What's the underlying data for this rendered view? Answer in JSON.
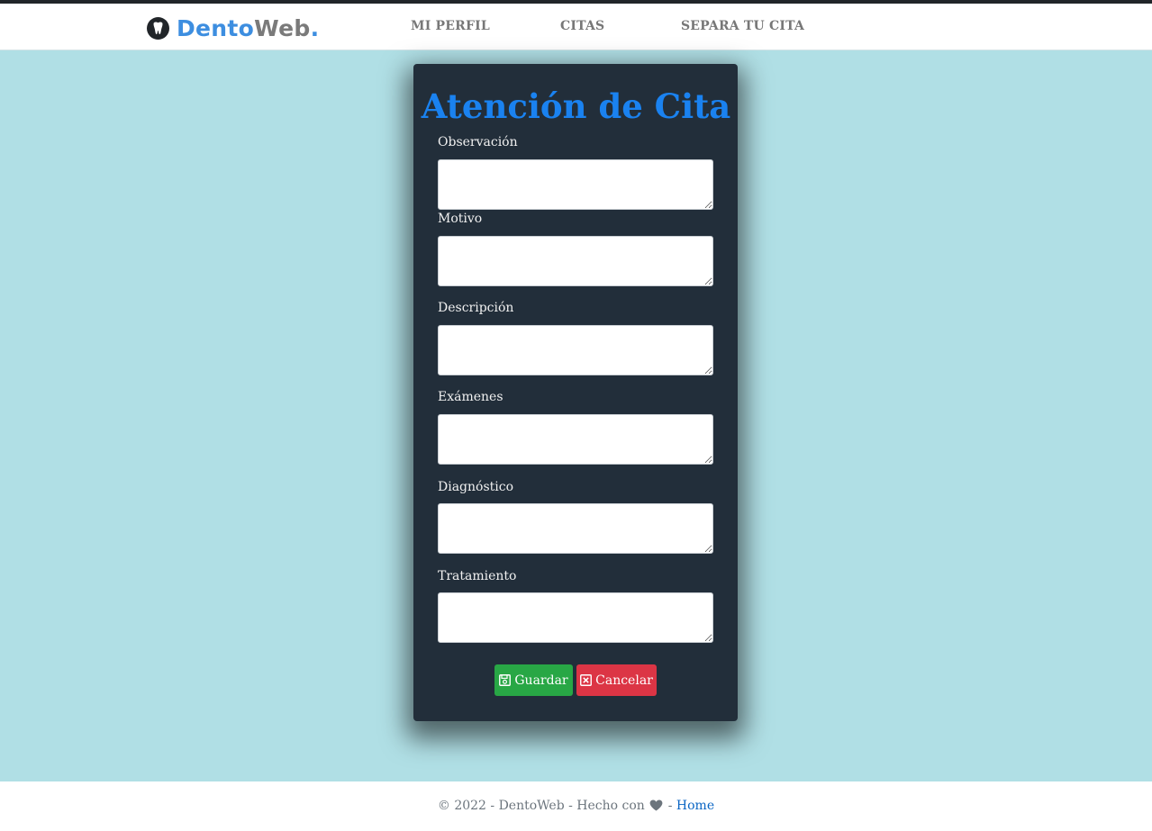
{
  "brand": {
    "name_part1": "Dento",
    "name_part2": "Web",
    "name_dot": ".",
    "logo_icon": "tooth-icon"
  },
  "nav": {
    "items": [
      {
        "label": "MI PERFIL"
      },
      {
        "label": "CITAS"
      },
      {
        "label": "SEPARA TU CITA"
      }
    ]
  },
  "form": {
    "title": "Atención de Cita",
    "fields": [
      {
        "label": "Observación",
        "value": ""
      },
      {
        "label": "Motivo",
        "value": ""
      },
      {
        "label": "Descripción",
        "value": ""
      },
      {
        "label": "Exámenes",
        "value": ""
      },
      {
        "label": "Diagnóstico",
        "value": ""
      },
      {
        "label": "Tratamiento",
        "value": ""
      }
    ],
    "save_label": "Guardar",
    "save_icon": "floppy-disk-icon",
    "cancel_label": "Cancelar",
    "cancel_icon": "close-square-icon"
  },
  "footer": {
    "prefix": "© 2022 - DentoWeb - Hecho con",
    "separator": "-",
    "home_link": "Home",
    "heart_icon": "heart-icon"
  },
  "colors": {
    "background": "#b0dfe5",
    "card": "#222e3a",
    "title": "#1a82f0",
    "save_button": "#28a745",
    "cancel_button": "#dc3545"
  }
}
